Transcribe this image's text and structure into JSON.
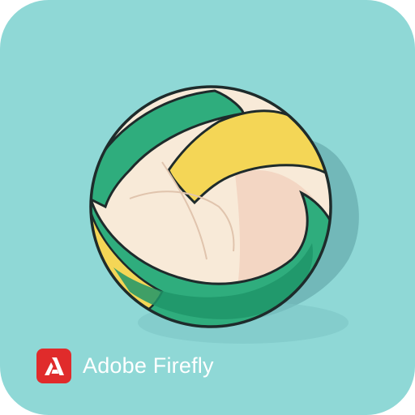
{
  "background": {
    "tile_color": "#8fd8d6",
    "shadow_color": "#6fb5b6"
  },
  "ball": {
    "subject": "volleyball",
    "outline_color": "#1e2b2b",
    "colors": {
      "green": "#2fad7d",
      "green_dark": "#1f9568",
      "yellow": "#f4d656",
      "cream": "#f8ead8",
      "cream_shadow": "#efd9c3",
      "peach": "#f3d6c3"
    }
  },
  "watermark": {
    "brand_text": "Adobe Firefly",
    "logo_icon": "adobe-firefly-logo-icon",
    "logo_color": "#e02b2b"
  }
}
